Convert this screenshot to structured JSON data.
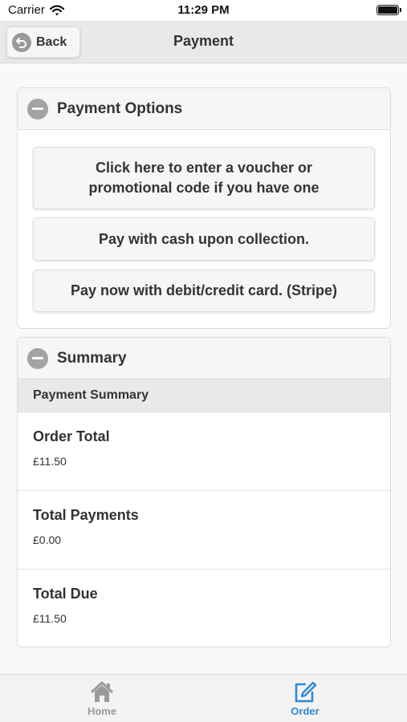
{
  "status_bar": {
    "carrier": "Carrier",
    "time": "11:29 PM"
  },
  "header": {
    "back_label": "Back",
    "title": "Payment"
  },
  "payment_options": {
    "title": "Payment Options",
    "buttons": [
      "Click here to enter a voucher or promotional code if you have one",
      "Pay with cash upon collection.",
      "Pay now with debit/credit card. (Stripe)"
    ]
  },
  "summary": {
    "title": "Summary",
    "divider": "Payment Summary",
    "rows": [
      {
        "label": "Order Total",
        "value": "£11.50"
      },
      {
        "label": "Total Payments",
        "value": "£0.00"
      },
      {
        "label": "Total Due",
        "value": "£11.50"
      }
    ]
  },
  "tabs": [
    {
      "label": "Home",
      "icon": "home-icon"
    },
    {
      "label": "Order",
      "icon": "edit-icon",
      "active": true
    }
  ],
  "colors": {
    "accent": "#3388cc",
    "inactive": "#9a9a9a"
  }
}
